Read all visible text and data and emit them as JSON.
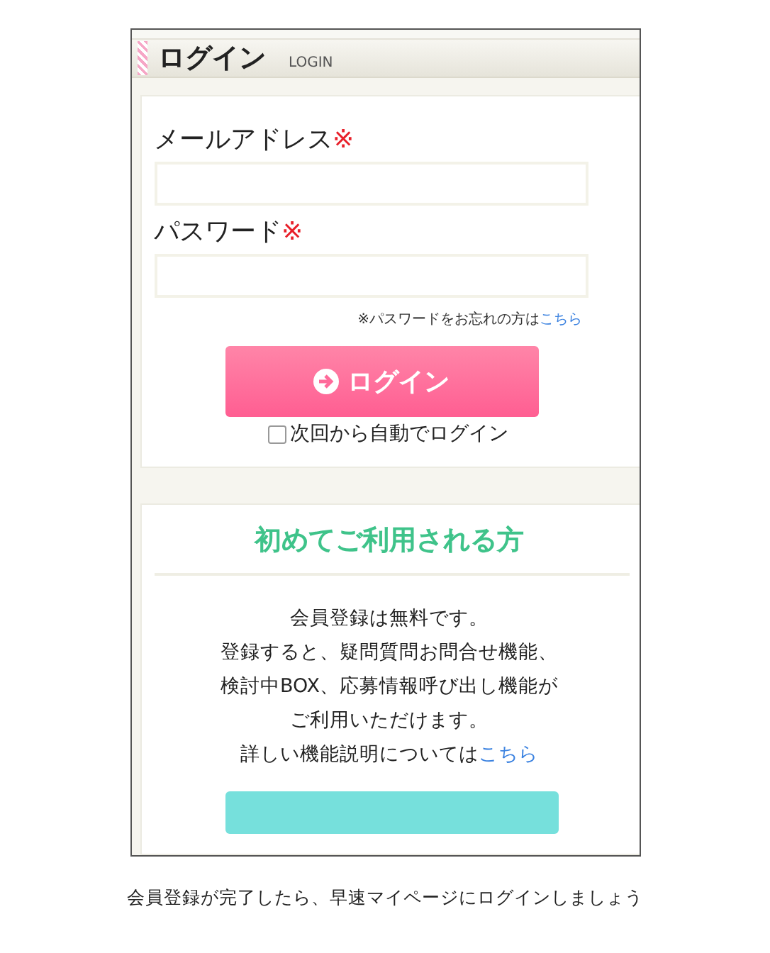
{
  "header": {
    "title": "ログイン",
    "subtitle": "LOGIN"
  },
  "login_form": {
    "fields": [
      {
        "label": "メールアドレス",
        "required_mark": "※"
      },
      {
        "label": "パスワード",
        "required_mark": "※"
      }
    ],
    "forgot": {
      "text": "※パスワードをお忘れの方は",
      "link": "こちら"
    },
    "submit": {
      "label": "ログイン"
    },
    "auto_login": {
      "label": "次回から自動でログイン",
      "checked": false
    }
  },
  "first_time": {
    "title": "初めてご利用される方",
    "lines": [
      "会員登録は無料です。",
      "登録すると、疑問質問お問合せ機能、",
      "検討中BOX、応募情報呼び出し機能が",
      "ご利用いただけます。"
    ],
    "last_line": {
      "text": "詳しい機能説明については",
      "link": "こちら"
    }
  },
  "caption": "会員登録が完了したら、早速マイページにログインしましょう"
}
